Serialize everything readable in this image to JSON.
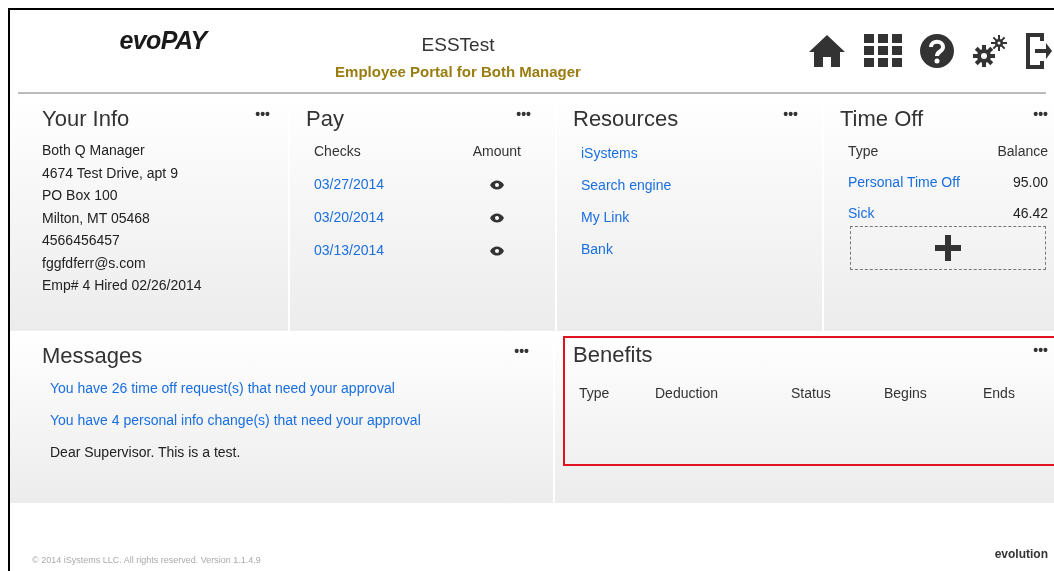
{
  "header": {
    "logo": "evoPAY",
    "title": "ESSTest",
    "subtitle": "Employee Portal for Both Manager"
  },
  "your_info": {
    "title": "Your Info",
    "menu": "•••",
    "lines": [
      "Both Q Manager",
      "4674 Test Drive, apt 9",
      "PO Box 100",
      "Milton, MT 05468",
      "4566456457",
      "fggfdferr@s.com",
      "Emp# 4 Hired 02/26/2014"
    ]
  },
  "pay": {
    "title": "Pay",
    "menu": "•••",
    "columns": [
      "Checks",
      "Amount"
    ],
    "checks": [
      "03/27/2014",
      "03/20/2014",
      "03/13/2014"
    ]
  },
  "resources": {
    "title": "Resources",
    "menu": "•••",
    "links": [
      "iSystems",
      "Search engine",
      "My Link",
      "Bank"
    ]
  },
  "time_off": {
    "title": "Time Off",
    "menu": "•••",
    "columns": [
      "Type",
      "Balance"
    ],
    "rows": [
      {
        "type": "Personal Time Off",
        "balance": "95.00"
      },
      {
        "type": "Sick",
        "balance": "46.42"
      }
    ]
  },
  "messages": {
    "title": "Messages",
    "menu": "•••",
    "items": [
      {
        "text": "You have 26 time off request(s) that need your approval",
        "kind": "link"
      },
      {
        "text": "You have 4 personal info change(s) that need your approval",
        "kind": "link"
      },
      {
        "text": "Dear Supervisor. This is a test.",
        "kind": "plain"
      }
    ]
  },
  "benefits": {
    "title": "Benefits",
    "menu": "•••",
    "highlighted": true,
    "columns": [
      "Type",
      "Deduction",
      "Status",
      "Begins",
      "Ends"
    ]
  },
  "footer": {
    "copyright": "© 2014 iSystems LLC. All rights reserved. Version 1.1.4.9",
    "logo": "evolution"
  }
}
